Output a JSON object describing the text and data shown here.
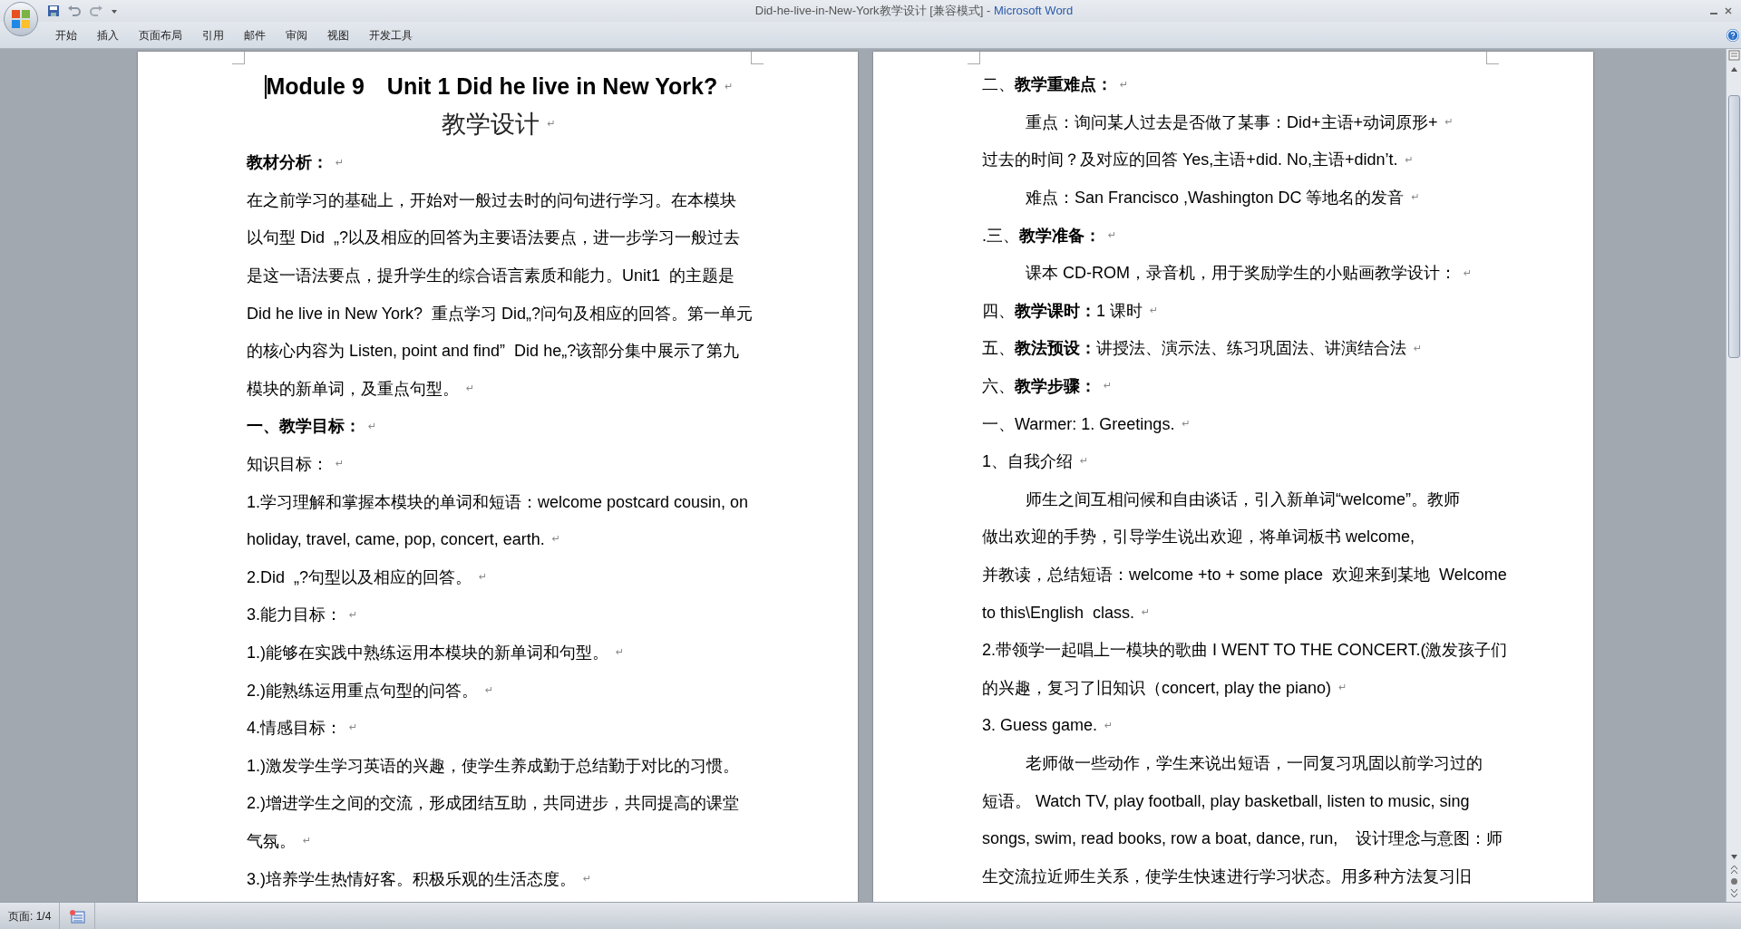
{
  "window": {
    "title": "Did-he-live-in-New-York教学设计 [兼容模式]",
    "separator": " - ",
    "app_name": "Microsoft Word"
  },
  "ribbon_tabs": [
    {
      "label": "开始"
    },
    {
      "label": "插入"
    },
    {
      "label": "页面布局"
    },
    {
      "label": "引用"
    },
    {
      "label": "邮件"
    },
    {
      "label": "审阅"
    },
    {
      "label": "视图"
    },
    {
      "label": "开发工具"
    }
  ],
  "pages": [
    {
      "title": "Module 9　Unit 1 Did he live in New York?",
      "title_mark": "↵",
      "subtitle": "教学设计",
      "subtitle_mark": "↵",
      "lines": [
        {
          "text": "**教材分析：**",
          "mark": "↵"
        },
        {
          "text": "在之前学习的基础上，开始对一般过去时的问句进行学习。在本模块"
        },
        {
          "text": "以句型 Did  „?以及相应的回答为主要语法要点，进一步学习一般过去"
        },
        {
          "text": "是这一语法要点，提升学生的综合语言素质和能力。Unit1  的主题是"
        },
        {
          "text": "Did he live in New York?  重点学习 Did„?问句及相应的回答。第一单元"
        },
        {
          "text": "的核心内容为 Listen, point and find”  Did he„?该部分集中展示了第九"
        },
        {
          "text": "模块的新单词，及重点句型。",
          "mark": "↵"
        },
        {
          "text": "**一、教学目标：**",
          "mark": "↵"
        },
        {
          "text": "知识目标：",
          "mark": "↵"
        },
        {
          "text": "1.学习理解和掌握本模块的单词和短语：welcome postcard cousin, on"
        },
        {
          "text": "holiday, travel, came, pop, concert, earth.",
          "mark": "↵"
        },
        {
          "text": "2.Did  „?句型以及相应的回答。",
          "mark": "↵"
        },
        {
          "text": "3.能力目标：",
          "mark": "↵"
        },
        {
          "text": "1.)能够在实践中熟练运用本模块的新单词和句型。",
          "mark": "↵"
        },
        {
          "text": "2.)能熟练运用重点句型的问答。",
          "mark": "↵"
        },
        {
          "text": "4.情感目标：",
          "mark": "↵"
        },
        {
          "text": "1.)激发学生学习英语的兴趣，使学生养成勤于总结勤于对比的习惯。"
        },
        {
          "text": "2.)增进学生之间的交流，形成团结互助，共同进步，共同提高的课堂"
        },
        {
          "text": "气氛。",
          "mark": "↵"
        },
        {
          "text": "3.)培养学生热情好客。积极乐观的生活态度。",
          "mark": "↵"
        }
      ]
    },
    {
      "lines": [
        {
          "text": "二、**教学重难点：**",
          "mark": "↵"
        },
        {
          "text": "重点：询问某人过去是否做了某事：Did+主语+动词原形+",
          "mark": "↵",
          "indent": true
        },
        {
          "text": "过去的时间？及对应的回答 Yes,主语+did. No,主语+didn’t.",
          "mark": "↵"
        },
        {
          "text": "难点：San Francisco ,Washington DC 等地名的发音",
          "mark": "↵",
          "indent": true
        },
        {
          "text": ".三、**教学准备：**",
          "mark": "↵"
        },
        {
          "text": "课本 CD-ROM，录音机，用于奖励学生的小贴画教学设计：",
          "mark": "↵",
          "indent": true
        },
        {
          "text": "四、**教学课时：**1 课时",
          "mark": "↵"
        },
        {
          "text": "五、**教法预设：**讲授法、演示法、练习巩固法、讲演结合法",
          "mark": "↵"
        },
        {
          "text": "六、**教学步骤：**",
          "mark": "↵"
        },
        {
          "text": "一、Warmer: 1. Greetings.",
          "mark": "↵"
        },
        {
          "text": "1、自我介绍",
          "mark": "↵"
        },
        {
          "text": "师生之间互相问候和自由谈话，引入新单词“welcome”。教师",
          "indent": true
        },
        {
          "text": "做出欢迎的手势，引导学生说出欢迎，将单词板书 welcome,"
        },
        {
          "text": "并教读，总结短语：welcome +to + some place  欢迎来到某地  Welcome"
        },
        {
          "text": "to this\\English  class.",
          "mark": "↵"
        },
        {
          "text": "2.带领学一起唱上一模块的歌曲 I WENT TO THE CONCERT.(激发孩子们"
        },
        {
          "text": "的兴趣，复习了旧知识（concert, play the piano)",
          "mark": "↵"
        },
        {
          "text": "3. Guess game.",
          "mark": "↵"
        },
        {
          "text": "老师做一些动作，学生来说出短语，一同复习巩固以前学习过的",
          "indent": true
        },
        {
          "text": "短语。 Watch TV, play football, play basketball, listen to music, sing"
        },
        {
          "text": "songs, swim, read books, row a boat, dance, run,    设计理念与意图：师"
        },
        {
          "text": "生交流拉近师生关系，使学生快速进行学习状态。用多种方法复习旧"
        }
      ]
    }
  ],
  "status_bar": {
    "page": "页面: 1/4"
  }
}
